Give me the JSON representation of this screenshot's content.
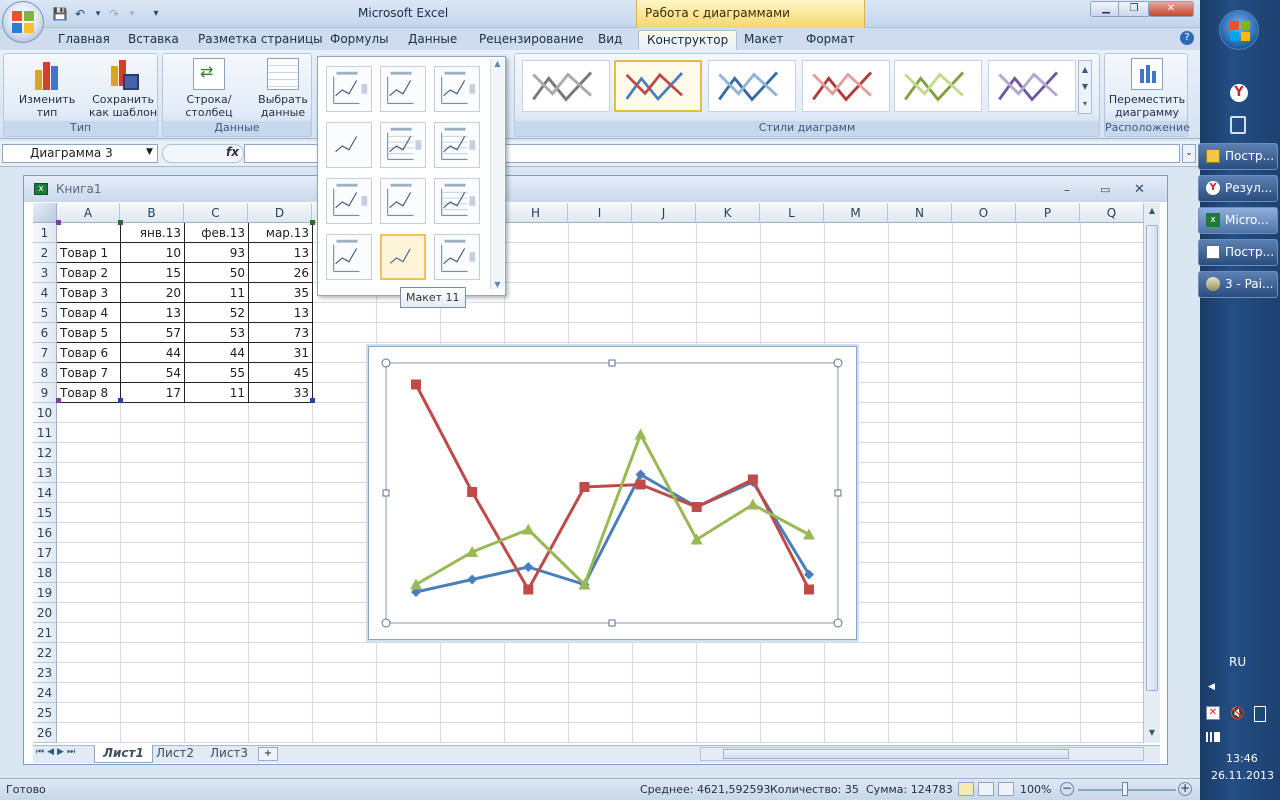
{
  "window": {
    "title": "Microsoft Excel",
    "context_header": "Работа с диаграммами"
  },
  "tabs": [
    {
      "label": "Главная"
    },
    {
      "label": "Вставка"
    },
    {
      "label": "Разметка страницы"
    },
    {
      "label": "Формулы"
    },
    {
      "label": "Данные"
    },
    {
      "label": "Рецензирование"
    },
    {
      "label": "Вид"
    },
    {
      "label": "Конструктор",
      "active": true
    },
    {
      "label": "Макет"
    },
    {
      "label": "Формат"
    }
  ],
  "ribbon": {
    "type_group": {
      "label": "Тип",
      "change_type": "Изменить тип диаграммы",
      "save_template": "Сохранить как шаблон"
    },
    "data_group": {
      "label": "Данные",
      "row_col": "Строка/столбец",
      "select_data": "Выбрать данные"
    },
    "styles_group": {
      "label": "Стили диаграмм"
    },
    "location_group": {
      "label": "Расположение",
      "move_chart": "Переместить диаграмму"
    }
  },
  "formula_bar": {
    "name_box": "Диаграмма 3",
    "fx": "fx",
    "formula": ""
  },
  "workbook": {
    "title": "Книга1"
  },
  "columns": [
    "A",
    "B",
    "C",
    "D",
    "E",
    "F",
    "G",
    "H",
    "I",
    "J",
    "K",
    "L",
    "M",
    "N",
    "O",
    "P",
    "Q"
  ],
  "rows": [
    1,
    2,
    3,
    4,
    5,
    6,
    7,
    8,
    9,
    10,
    11,
    12,
    13,
    14,
    15,
    16,
    17,
    18,
    19,
    20,
    21,
    22,
    23,
    24,
    25,
    26
  ],
  "table": {
    "headers": [
      "",
      "янв.13",
      "фев.13",
      "мар.13"
    ],
    "rows": [
      [
        "Товар 1",
        "10",
        "93",
        "13"
      ],
      [
        "Товар 2",
        "15",
        "50",
        "26"
      ],
      [
        "Товар 3",
        "20",
        "11",
        "35"
      ],
      [
        "Товар 4",
        "13",
        "52",
        "13"
      ],
      [
        "Товар 5",
        "57",
        "53",
        "73"
      ],
      [
        "Товар 6",
        "44",
        "44",
        "31"
      ],
      [
        "Товар 7",
        "54",
        "55",
        "45"
      ],
      [
        "Товар 8",
        "17",
        "11",
        "33"
      ]
    ]
  },
  "gallery": {
    "tooltip": "Макет 11",
    "selected_index": 10
  },
  "sheets": [
    {
      "label": "Лист1",
      "active": true
    },
    {
      "label": "Лист2"
    },
    {
      "label": "Лист3"
    }
  ],
  "status": {
    "ready": "Готово",
    "average": "Среднее: 4621,592593",
    "count": "Количество: 35",
    "sum": "Сумма: 124783",
    "zoom": "100%"
  },
  "taskbar": {
    "items": [
      {
        "label": "Постр..."
      },
      {
        "label": "Резул..."
      },
      {
        "label": "Micro...",
        "active": true
      },
      {
        "label": "Постр..."
      },
      {
        "label": "3 - Pai..."
      }
    ],
    "lang": "RU",
    "time": "13:46",
    "date": "26.11.2013"
  },
  "chart_data": {
    "type": "line",
    "categories": [
      "Товар 1",
      "Товар 2",
      "Товар 3",
      "Товар 4",
      "Товар 5",
      "Товар 6",
      "Товар 7",
      "Товар 8"
    ],
    "ylim": [
      0,
      100
    ],
    "grid": false,
    "legend": "none",
    "series": [
      {
        "values": [
          10,
          15,
          20,
          13,
          57,
          44,
          54,
          17
        ],
        "color": "#4a7ebb",
        "marker": "diamond"
      },
      {
        "values": [
          93,
          50,
          11,
          52,
          53,
          44,
          55,
          11
        ],
        "color": "#be4b48",
        "marker": "square"
      },
      {
        "values": [
          13,
          26,
          35,
          13,
          73,
          31,
          45,
          33
        ],
        "color": "#98b954",
        "marker": "triangle"
      }
    ]
  }
}
